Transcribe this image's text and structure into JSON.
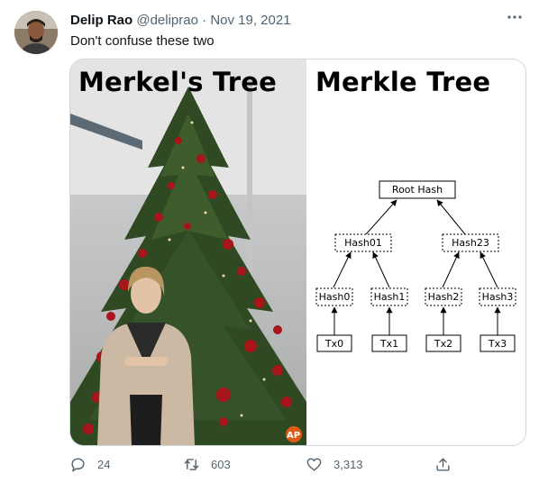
{
  "tweet": {
    "author_name": "Delip Rao",
    "handle": "@deliprao",
    "separator": "·",
    "date": "Nov 19, 2021",
    "text": "Don't confuse these two"
  },
  "media": {
    "left_caption": "Merkel's Tree",
    "right_caption": "Merkle Tree",
    "watermark": "AP",
    "diagram": {
      "root": "Root Hash",
      "level1": [
        "Hash01",
        "Hash23"
      ],
      "level2": [
        "Hash0",
        "Hash1",
        "Hash2",
        "Hash3"
      ],
      "leaves": [
        "Tx0",
        "Tx1",
        "Tx2",
        "Tx3"
      ]
    }
  },
  "actions": {
    "reply_count": "24",
    "retweet_count": "603",
    "like_count": "3,313"
  },
  "icons": {
    "more": "more-icon",
    "reply": "reply-icon",
    "retweet": "retweet-icon",
    "like": "heart-icon",
    "share": "share-icon"
  },
  "colors": {
    "text": "#0f1419",
    "muted": "#536471",
    "border": "#cfd9de"
  }
}
